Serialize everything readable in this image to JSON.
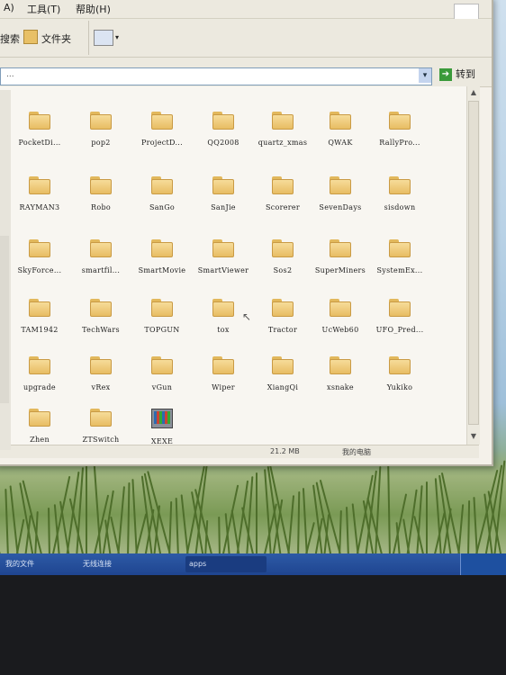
{
  "menubar": {
    "items": [
      {
        "label": "A)"
      },
      {
        "label": "工具(T)"
      },
      {
        "label": "帮助(H)"
      }
    ]
  },
  "toolbar": {
    "search_label": "搜索",
    "folders_label": "文件夹"
  },
  "address": {
    "path_hint": "...",
    "go_label": "转到"
  },
  "folders": [
    {
      "label": "PocketDi..."
    },
    {
      "label": "pop2"
    },
    {
      "label": "ProjectD..."
    },
    {
      "label": "QQ2008"
    },
    {
      "label": "quartz_xmas"
    },
    {
      "label": "QWAK"
    },
    {
      "label": "RallyPro..."
    },
    {
      "label": "RAYMAN3"
    },
    {
      "label": "Robo"
    },
    {
      "label": "SanGo"
    },
    {
      "label": "SanJie"
    },
    {
      "label": "Scorerer"
    },
    {
      "label": "SevenDays"
    },
    {
      "label": "sisdown"
    },
    {
      "label": "SkyForce..."
    },
    {
      "label": "smartfil..."
    },
    {
      "label": "SmartMovie"
    },
    {
      "label": "SmartViewer"
    },
    {
      "label": "Sos2"
    },
    {
      "label": "SuperMiners"
    },
    {
      "label": "SystemEx..."
    },
    {
      "label": "TAM1942"
    },
    {
      "label": "TechWars"
    },
    {
      "label": "TOPGUN"
    },
    {
      "label": "tox"
    },
    {
      "label": "Tractor"
    },
    {
      "label": "UcWeb60"
    },
    {
      "label": "UFO_Pred..."
    },
    {
      "label": "upgrade"
    },
    {
      "label": "vRex"
    },
    {
      "label": "vGun"
    },
    {
      "label": "Wiper"
    },
    {
      "label": "XiangQi"
    },
    {
      "label": "xsnake"
    },
    {
      "label": "Yukiko"
    },
    {
      "label": "Zhen"
    },
    {
      "label": "ZTSwitch"
    },
    {
      "label": "XEXE"
    }
  ],
  "status": {
    "size": "21.2 MB",
    "location": "我的电脑"
  },
  "taskbar": {
    "items": [
      {
        "label": "我的文件"
      },
      {
        "label": "无线连接"
      },
      {
        "label": "apps"
      }
    ]
  }
}
